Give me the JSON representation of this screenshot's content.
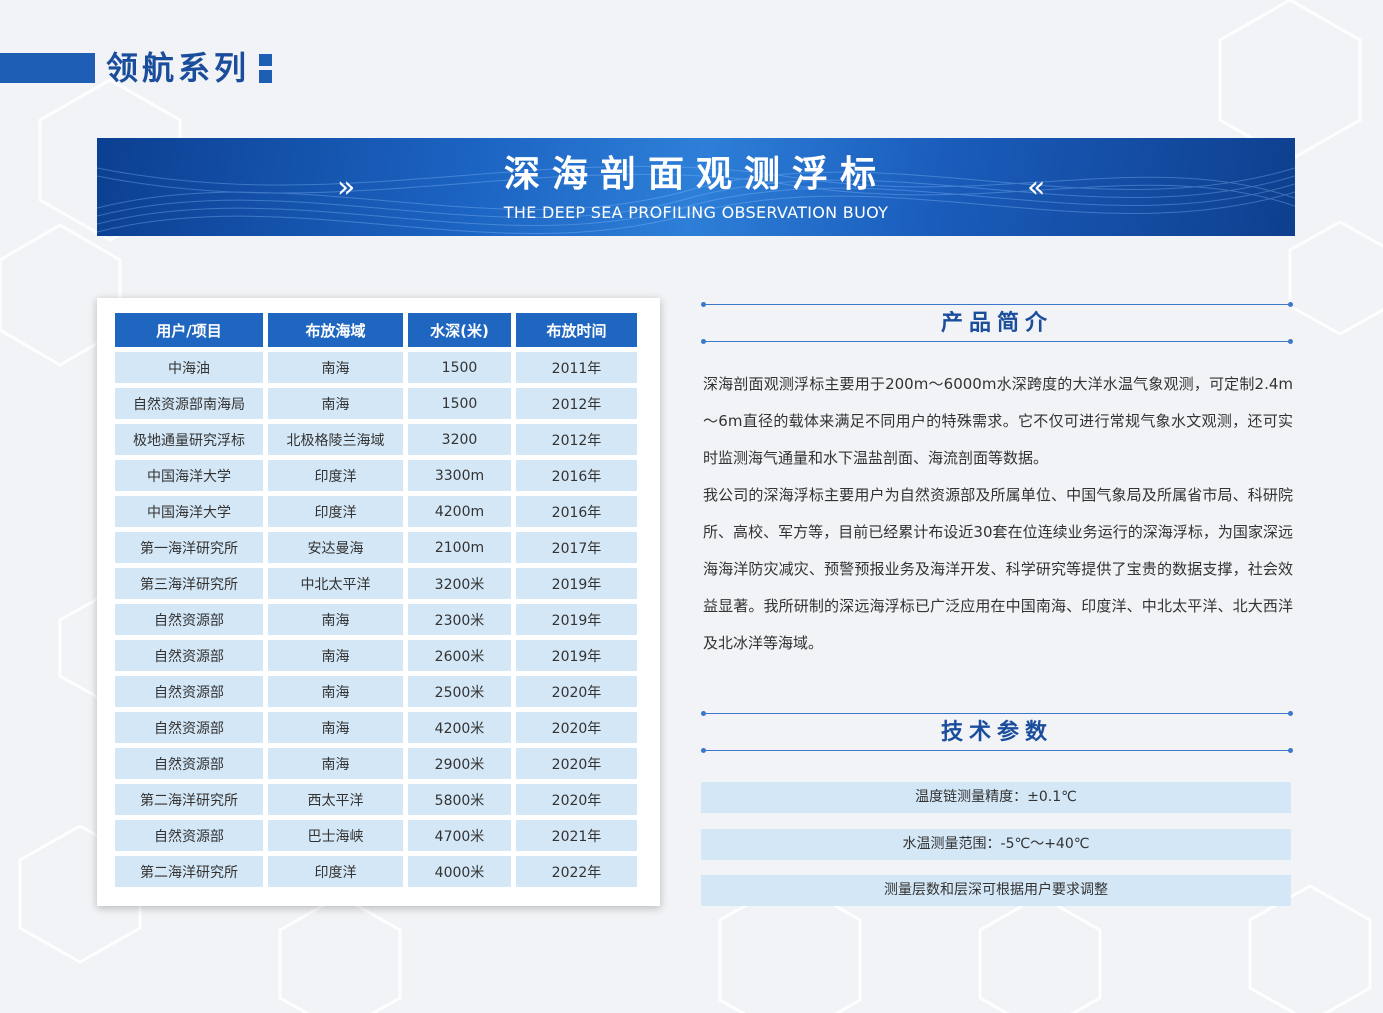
{
  "series": {
    "title": "领航系列"
  },
  "banner": {
    "title": "深海剖面观测浮标",
    "subtitle": "THE DEEP SEA PROFILING OBSERVATION BUOY",
    "chevron_left": "»",
    "chevron_right": "«"
  },
  "table": {
    "headers": [
      "用户/项目",
      "布放海域",
      "水深(米)",
      "布放时间"
    ],
    "rows": [
      [
        "中海油",
        "南海",
        "1500",
        "2011年"
      ],
      [
        "自然资源部南海局",
        "南海",
        "1500",
        "2012年"
      ],
      [
        "极地通量研究浮标",
        "北极格陵兰海域",
        "3200",
        "2012年"
      ],
      [
        "中国海洋大学",
        "印度洋",
        "3300m",
        "2016年"
      ],
      [
        "中国海洋大学",
        "印度洋",
        "4200m",
        "2016年"
      ],
      [
        "第一海洋研究所",
        "安达曼海",
        "2100m",
        "2017年"
      ],
      [
        "第三海洋研究所",
        "中北太平洋",
        "3200米",
        "2019年"
      ],
      [
        "自然资源部",
        "南海",
        "2300米",
        "2019年"
      ],
      [
        "自然资源部",
        "南海",
        "2600米",
        "2019年"
      ],
      [
        "自然资源部",
        "南海",
        "2500米",
        "2020年"
      ],
      [
        "自然资源部",
        "南海",
        "4200米",
        "2020年"
      ],
      [
        "自然资源部",
        "南海",
        "2900米",
        "2020年"
      ],
      [
        "第二海洋研究所",
        "西太平洋",
        "5800米",
        "2020年"
      ],
      [
        "自然资源部",
        "巴士海峡",
        "4700米",
        "2021年"
      ],
      [
        "第二海洋研究所",
        "印度洋",
        "4000米",
        "2022年"
      ]
    ]
  },
  "intro": {
    "heading": "产品简介",
    "paragraphs": [
      "深海剖面观测浮标主要用于200m～6000m水深跨度的大洋水温气象观测，可定制2.4m～6m直径的载体来满足不同用户的特殊需求。它不仅可进行常规气象水文观测，还可实时监测海气通量和水下温盐剖面、海流剖面等数据。",
      "我公司的深海浮标主要用户为自然资源部及所属单位、中国气象局及所属省市局、科研院所、高校、军方等，目前已经累计布设近30套在位连续业务运行的深海浮标，为国家深远海海洋防灾减灾、预警预报业务及海洋开发、科学研究等提供了宝贵的数据支撑，社会效益显著。我所研制的深远海浮标已广泛应用在中国南海、印度洋、中北太平洋、北大西洋及北冰洋等海域。"
    ]
  },
  "params": {
    "heading": "技术参数",
    "items": [
      "温度链测量精度：±0.1℃",
      "水温测量范围：-5℃～+40℃",
      "测量层数和层深可根据用户要求调整"
    ]
  },
  "colors": {
    "primary": "#1e5fb5",
    "cell": "#d4e7f6",
    "heading": "#1a4d9c"
  }
}
